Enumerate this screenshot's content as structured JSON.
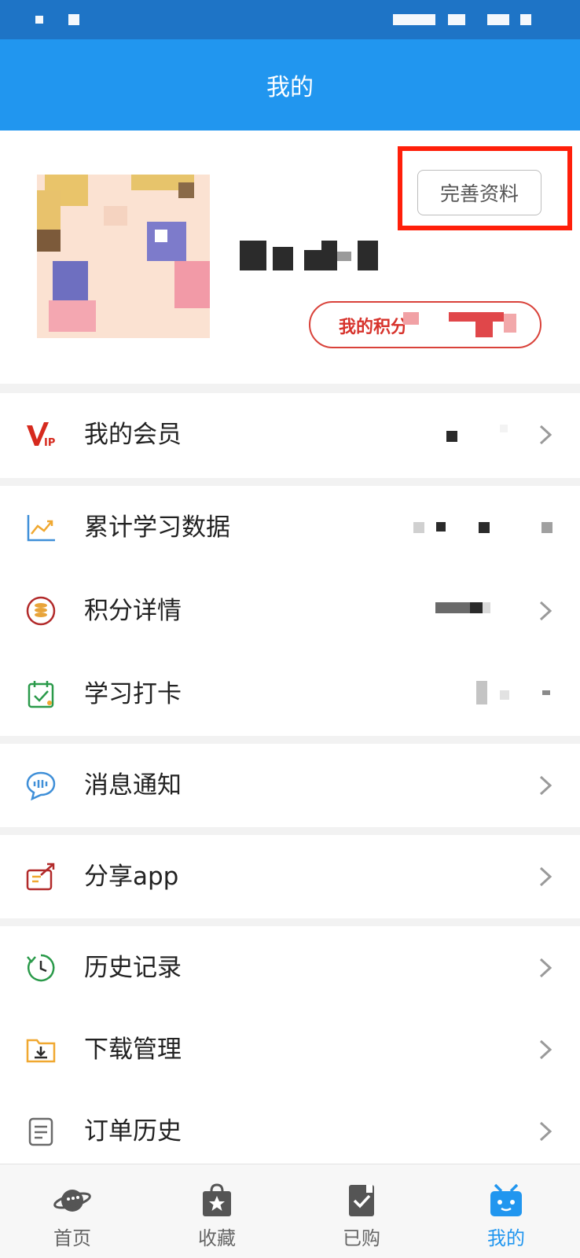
{
  "header": {
    "title": "我的"
  },
  "profile": {
    "edit_button": "完善资料",
    "points_label": "我的积分"
  },
  "menu": {
    "membership": {
      "label": "我的会员",
      "icon": "vip-icon"
    },
    "study_data": {
      "label": "累计学习数据",
      "icon": "chart-line-icon"
    },
    "points_detail": {
      "label": "积分详情",
      "icon": "coin-stack-icon"
    },
    "checkin": {
      "label": "学习打卡",
      "icon": "calendar-check-icon"
    },
    "notifications": {
      "label": "消息通知",
      "icon": "message-bubble-icon"
    },
    "share": {
      "label": "分享app",
      "icon": "share-icon"
    },
    "history": {
      "label": "历史记录",
      "icon": "clock-history-icon"
    },
    "downloads": {
      "label": "下载管理",
      "icon": "download-folder-icon"
    },
    "orders": {
      "label": "订单历史",
      "icon": "document-icon"
    }
  },
  "tabs": [
    {
      "label": "首页",
      "icon": "planet-icon"
    },
    {
      "label": "收藏",
      "icon": "bag-star-icon"
    },
    {
      "label": "已购",
      "icon": "clipboard-check-icon"
    },
    {
      "label": "我的",
      "icon": "tv-face-icon",
      "active": true
    }
  ],
  "colors": {
    "primary": "#2196ef",
    "highlight": "#ff1f0a",
    "accent_red": "#d7332c"
  }
}
